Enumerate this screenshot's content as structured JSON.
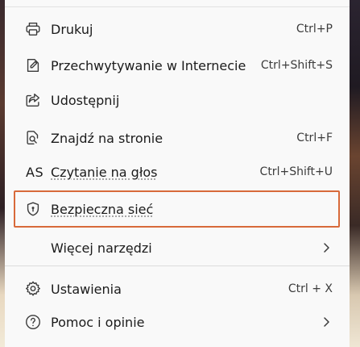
{
  "menu": {
    "items": [
      {
        "label": "Drukuj",
        "shortcut": "Ctrl+P",
        "icon": "printer-icon"
      },
      {
        "label": "Przechwytywanie w Internecie",
        "shortcut": "Ctrl+Shift+S",
        "icon": "web-capture-icon"
      },
      {
        "label": "Udostępnij",
        "shortcut": "",
        "icon": "share-icon"
      },
      {
        "label": "Znajdź na stronie",
        "shortcut": "Ctrl+F",
        "icon": "find-on-page-icon"
      },
      {
        "label": "Czytanie na głos",
        "shortcut": "Ctrl+Shift+U",
        "icon": "read-aloud-icon",
        "icon_text": "AS"
      },
      {
        "label": "Bezpieczna sieć",
        "shortcut": "",
        "icon": "shield-icon",
        "highlighted": true,
        "highlight_color": "#d86a3a"
      },
      {
        "label": "Więcej narzędzi",
        "shortcut": "",
        "icon": "",
        "submenu": true
      },
      {
        "label": "Ustawienia",
        "shortcut": "Ctrl + X",
        "icon": "gear-icon"
      },
      {
        "label": "Pomoc i opinie",
        "shortcut": "",
        "icon": "help-icon",
        "submenu": true
      }
    ]
  }
}
